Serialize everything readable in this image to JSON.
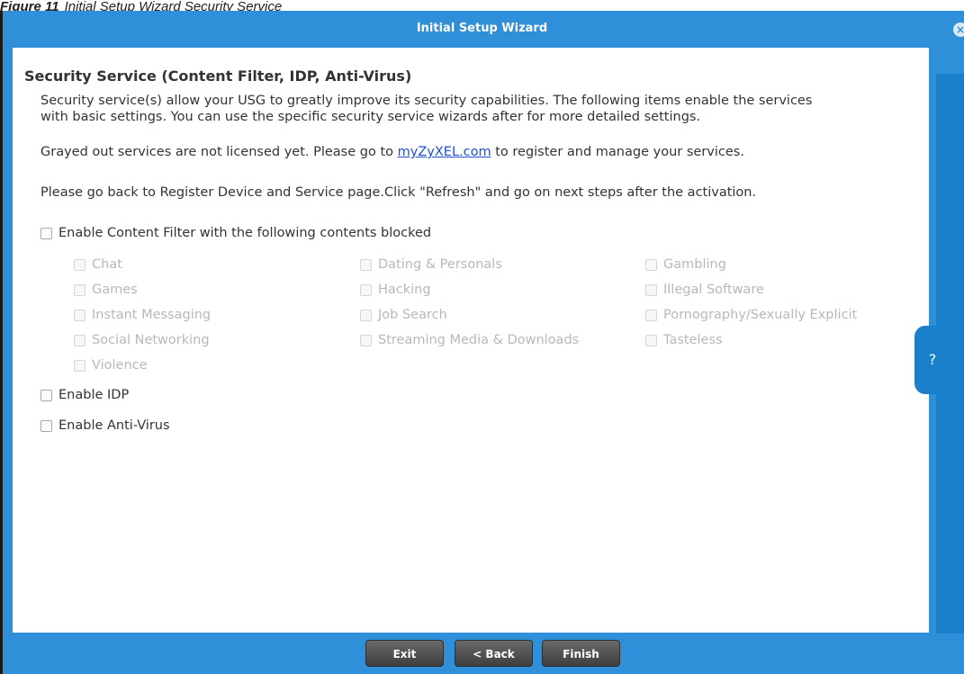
{
  "caption": {
    "figure": "Figure 11",
    "text": "Initial Setup Wizard Security Service"
  },
  "dialog": {
    "title": "Initial Setup Wizard",
    "close_icon": "×",
    "help_icon": "?"
  },
  "section": {
    "title": "Security Service (Content Filter, IDP, Anti-Virus)",
    "para1_line1": "Security service(s) allow your USG to greatly improve its security capabilities. The following items enable the services",
    "para1_line2": "with basic settings. You can use the specific security service wizards after for more detailed settings.",
    "para2_prefix": "Grayed out services are not licensed yet. Please go to ",
    "para2_link": "myZyXEL.com",
    "para2_suffix": " to register and manage your services.",
    "para3": "Please go back to Register Device and Service page.Click \"Refresh\" and go on next steps after the activation."
  },
  "options": {
    "content_filter": "Enable Content Filter with the following contents blocked",
    "categories": [
      "Chat",
      "Dating & Personals",
      "Gambling",
      "Games",
      "Hacking",
      "Illegal Software",
      "Instant Messaging",
      "Job Search",
      "Pornography/Sexually Explicit",
      "Social Networking",
      "Streaming Media & Downloads",
      "Tasteless",
      "Violence"
    ],
    "idp": "Enable IDP",
    "anti_virus": "Enable Anti-Virus"
  },
  "buttons": {
    "exit": "Exit",
    "back": "< Back",
    "finish": "Finish"
  },
  "colors": {
    "accent": "#2f8fd8",
    "strip": "#1b80cc",
    "link": "#1f4fd6",
    "disabled_text": "#b8b8b8"
  }
}
